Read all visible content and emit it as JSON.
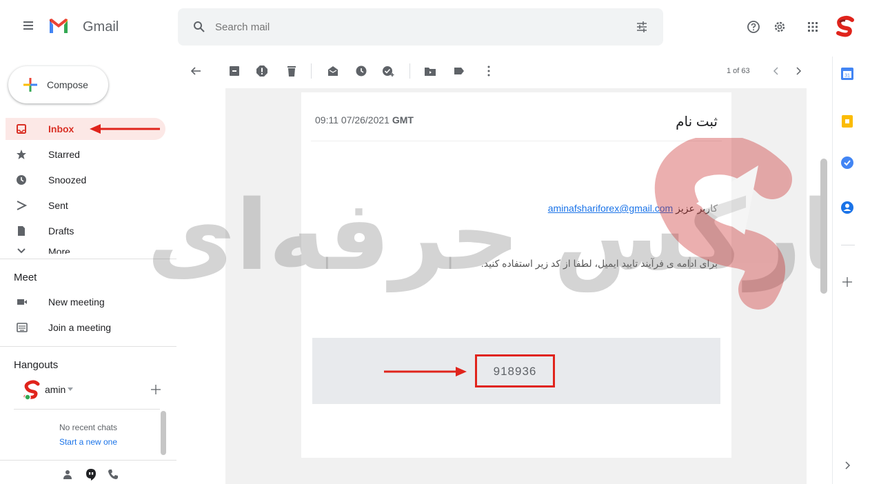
{
  "header": {
    "app_name": "Gmail",
    "search_placeholder": "Search mail"
  },
  "sidebar": {
    "compose_label": "Compose",
    "items": [
      {
        "label": "Inbox"
      },
      {
        "label": "Starred"
      },
      {
        "label": "Snoozed"
      },
      {
        "label": "Sent"
      },
      {
        "label": "Drafts"
      },
      {
        "label": "More"
      }
    ],
    "meet": {
      "title": "Meet",
      "new_meeting": "New meeting",
      "join_meeting": "Join a meeting"
    },
    "hangouts": {
      "title": "Hangouts",
      "user": "amin",
      "no_chats": "No recent chats",
      "start_new": "Start a new one"
    }
  },
  "toolbar": {
    "pagination": "1 of 63"
  },
  "message": {
    "date": "09:11 07/26/2021",
    "timezone": "GMT",
    "subject": "ثبت نام",
    "greeting_prefix": "کاربر عزیز",
    "email": "aminafshariforex@gmail.com",
    "body": "برای ادامه ی فرآیند تایید ایمیل، لطفا از کد زیر استفاده کنید.",
    "code": "918936"
  },
  "watermark": {
    "text": "فارکس حرفه‌ای"
  },
  "colors": {
    "accent_red": "#d93025",
    "annotation_red": "#e0241c",
    "link_blue": "#1a73e8"
  }
}
